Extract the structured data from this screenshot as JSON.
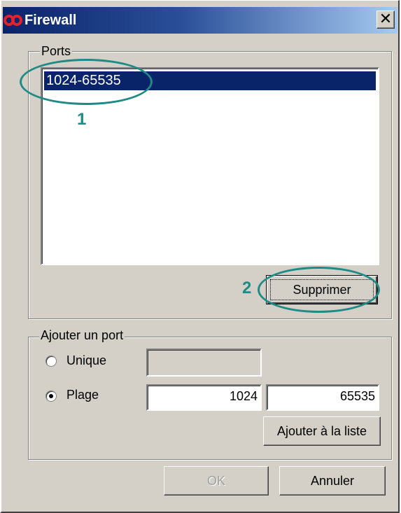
{
  "window": {
    "title": "Firewall",
    "close_glyph": "✕",
    "icon": "infinity-logo-icon"
  },
  "ports_group": {
    "legend": "Ports",
    "items": [
      {
        "label": "1024-65535",
        "selected": true
      }
    ],
    "delete_button": "Supprimer"
  },
  "add_group": {
    "legend": "Ajouter un port",
    "options": [
      {
        "label": "Unique",
        "selected": false
      },
      {
        "label": "Plage",
        "selected": true
      }
    ],
    "unique_value": "",
    "range_start": "1024",
    "range_end": "65535",
    "add_button": "Ajouter à la liste"
  },
  "footer": {
    "ok_label": "OK",
    "ok_enabled": false,
    "cancel_label": "Annuler"
  },
  "annotations": [
    {
      "number": "1"
    },
    {
      "number": "2"
    }
  ],
  "colors": {
    "selection": "#0a246a",
    "annotation": "#1f8a86",
    "dialog": "#d4d0c8",
    "logo": "#e8202a"
  }
}
